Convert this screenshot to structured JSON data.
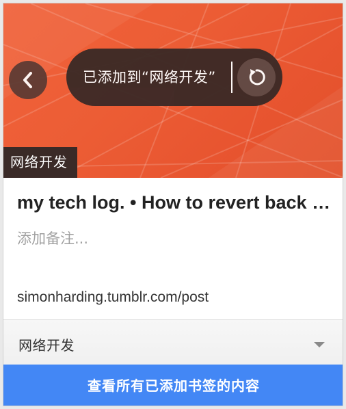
{
  "colors": {
    "hero_accent": "#ec5d35",
    "toast_background": "#3c2a26",
    "badge_background": "#3a2a27",
    "primary_button": "#4387f5"
  },
  "hero": {
    "back_icon": "chevron-left-icon",
    "toast": {
      "message": "已添加到“网络开发”",
      "undo_icon": "undo-icon"
    },
    "folder_badge": "网络开发"
  },
  "bookmark": {
    "title": "my tech log. • How to revert back to the previous commit",
    "note_placeholder": "添加备注...",
    "url": "simonharding.tumblr.com/post"
  },
  "folder_select": {
    "selected": "网络开发",
    "arrow_icon": "dropdown-arrow-icon"
  },
  "footer": {
    "view_all_label": "查看所有已添加书签的内容"
  }
}
